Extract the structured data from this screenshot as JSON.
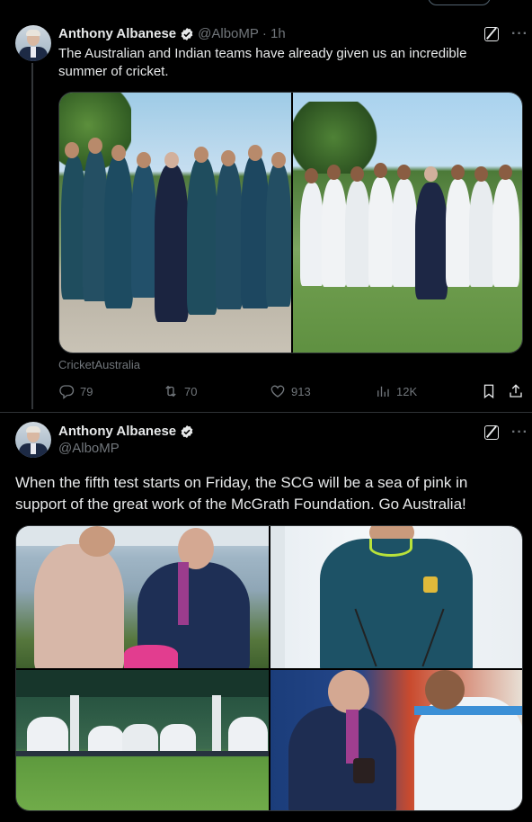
{
  "tweets": [
    {
      "author": "Anthony Albanese",
      "handle": "@AlboMP",
      "time": "· 1h",
      "text": "The Australian and Indian teams have already given us an incredible summer of cricket.",
      "media_source": "CricketAustralia",
      "stats": {
        "replies": "79",
        "reposts": "70",
        "likes": "913",
        "views": "12K"
      }
    },
    {
      "author": "Anthony Albanese",
      "handle": "@AlboMP",
      "text": "When the fifth test starts on Friday, the SCG will be a sea of pink in support of the great work of the McGrath Foundation. Go Australia!"
    }
  ],
  "icons": {
    "verified": "verified-badge-icon",
    "grok": "grok-icon",
    "more": "more-dots-icon",
    "reply": "reply-icon",
    "repost": "repost-icon",
    "like": "like-icon",
    "views": "views-icon",
    "bookmark": "bookmark-icon",
    "share": "share-icon"
  },
  "colors": {
    "background": "#000000",
    "text": "#e7e9ea",
    "secondary": "#71767b",
    "verified": "#e7e9ea",
    "australia_green": "#1f5a4a",
    "india_white": "#f1f3f5"
  },
  "more_glyph": "···"
}
